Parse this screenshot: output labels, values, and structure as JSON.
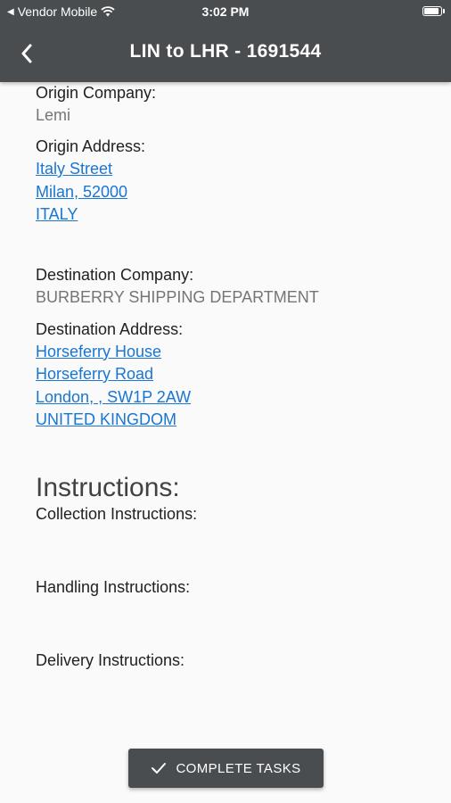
{
  "status_bar": {
    "carrier": "Vendor Mobile",
    "time": "3:02 PM",
    "battery_level": 0.95
  },
  "app_bar": {
    "title": "LIN to LHR - 1691544",
    "back_icon": "chevron-left-icon"
  },
  "origin": {
    "company_label": "Origin Company:",
    "company": "Lemi",
    "address_label": "Origin Address:",
    "address_lines": [
      "Italy Street",
      "Milan,  52000",
      "ITALY"
    ]
  },
  "destination": {
    "company_label": "Destination Company:",
    "company": "BURBERRY SHIPPING DEPARTMENT",
    "address_label": "Destination Address:",
    "address_lines": [
      "Horseferry House",
      "Horseferry Road",
      "London, , SW1P 2AW",
      "UNITED KINGDOM"
    ]
  },
  "instructions": {
    "heading": "Instructions:",
    "collection_label": "Collection Instructions:",
    "handling_label": "Handling Instructions:",
    "delivery_label": "Delivery Instructions:"
  },
  "actions": {
    "complete_label": "COMPLETE TASKS",
    "complete_icon": "check-icon"
  },
  "colors": {
    "bar": "#4a4d50",
    "link": "#1976d2",
    "background": "#fafafa"
  }
}
